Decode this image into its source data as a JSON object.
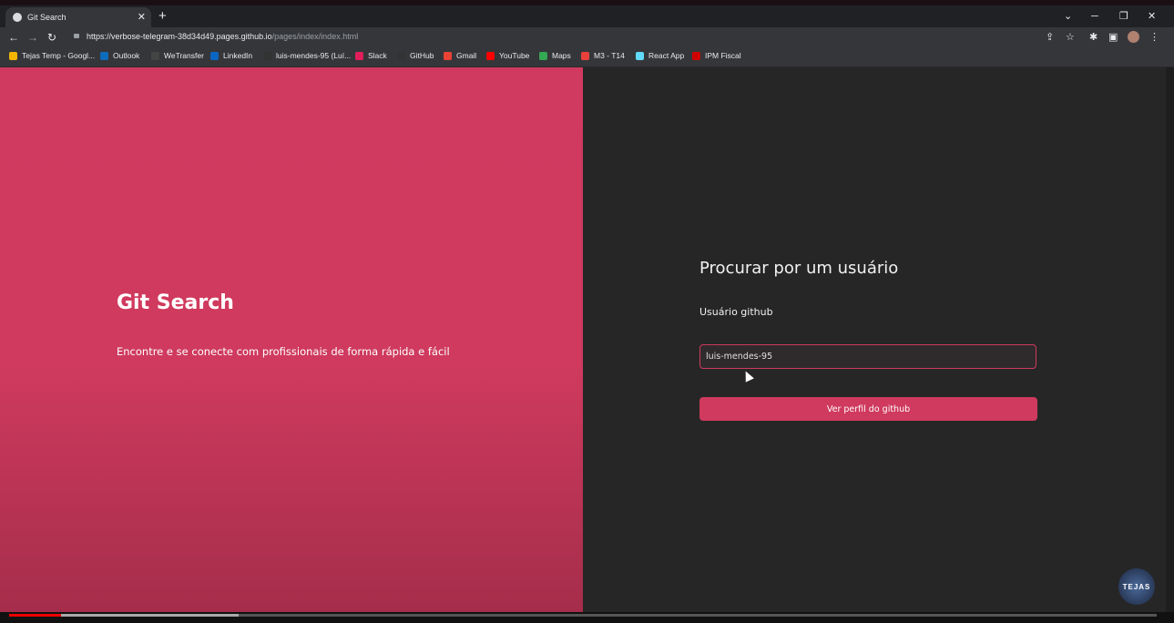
{
  "browser": {
    "tab_title": "Git Search",
    "tab_close": "✕",
    "new_tab": "+",
    "window_controls": [
      "⌄",
      "─",
      "❐",
      "✕"
    ],
    "nav": {
      "back": "←",
      "forward": "→",
      "reload": "↻"
    },
    "url_host": "https://verbose-telegram-38d34d49.pages.github.io",
    "url_path": "/pages/index/index.html",
    "bookmarks": [
      {
        "label": "Tejas Temp - Googl...",
        "color": "#f4b400"
      },
      {
        "label": "Outlook",
        "color": "#0f6cbd"
      },
      {
        "label": "WeTransfer",
        "color": "#444444"
      },
      {
        "label": "LinkedIn",
        "color": "#0a66c2"
      },
      {
        "label": "luis-mendes-95 (Luí...",
        "color": "#333333"
      },
      {
        "label": "Slack",
        "color": "#e01e5a"
      },
      {
        "label": "GitHub",
        "color": "#333333"
      },
      {
        "label": "Gmail",
        "color": "#ea4335"
      },
      {
        "label": "YouTube",
        "color": "#ff0000"
      },
      {
        "label": "Maps",
        "color": "#34a853"
      },
      {
        "label": "M3 - T14",
        "color": "#e8413c"
      },
      {
        "label": "React App",
        "color": "#61dafb"
      },
      {
        "label": "IPM Fiscal",
        "color": "#d00000"
      }
    ]
  },
  "page": {
    "hero_title": "Git Search",
    "hero_subtitle": "Encontre e se conecte com profissionais de forma rápida e fácil",
    "form_title": "Procurar por um usuário",
    "field_label": "Usuário github",
    "field_value": "luis-mendes-95",
    "submit_label": "Ver perfil do github"
  },
  "watermark": "TEJAS",
  "video_progress": {
    "played_fraction": 0.045,
    "buffered_fraction": 0.2
  },
  "colors": {
    "accent": "#cf3a5e",
    "panel_dark": "#262626"
  }
}
